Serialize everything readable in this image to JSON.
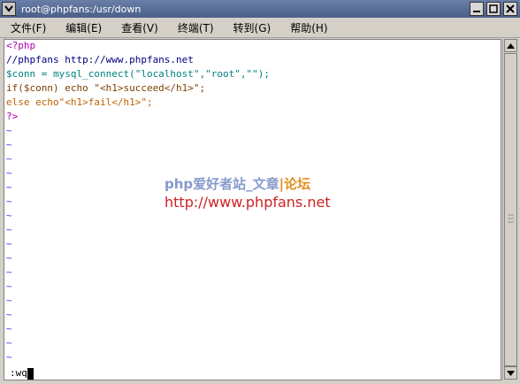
{
  "window": {
    "title": "root@phpfans:/usr/down"
  },
  "menu": [
    {
      "label": "文件(F)"
    },
    {
      "label": "编辑(E)"
    },
    {
      "label": "查看(V)"
    },
    {
      "label": "终端(T)"
    },
    {
      "label": "转到(G)"
    },
    {
      "label": "帮助(H)"
    }
  ],
  "code": {
    "line1": "<?php",
    "line2": "//phpfans http://www.phpfans.net",
    "line3": "$conn = mysql_connect(\"localhost\",\"root\",\"\");",
    "line4": "if($conn) echo \"<h1>succeed</h1>\";",
    "line5": "else echo\"<h1>fail</h1>\";",
    "line6": "?>"
  },
  "tilde": "~",
  "status_line": ":wq",
  "watermark": {
    "line1_main": "php爱好者站_文章",
    "line1_accent": "|论坛",
    "line2": "http://www.phpfans.net"
  },
  "colors": {
    "keyword": "#b000b0",
    "string": "#c06000",
    "variable": "#008080",
    "tilde": "#4040ff"
  }
}
